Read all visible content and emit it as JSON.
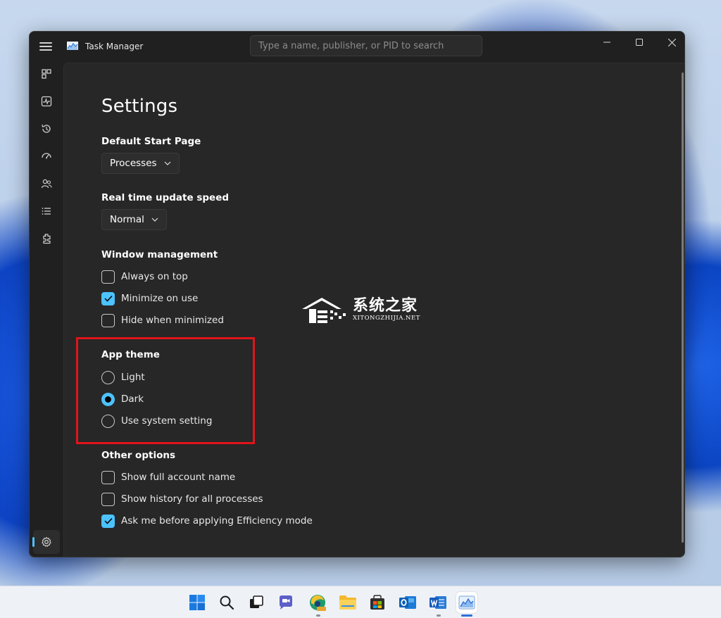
{
  "window": {
    "title": "Task Manager",
    "search_placeholder": "Type a name, publisher, or PID to search"
  },
  "nav": {
    "items": [
      "processes-icon",
      "performance-icon",
      "app-history-icon",
      "startup-apps-icon",
      "users-icon",
      "details-icon",
      "services-icon"
    ],
    "footer": "settings-icon"
  },
  "settings": {
    "title": "Settings",
    "default_start_page": {
      "label": "Default Start Page",
      "value": "Processes"
    },
    "update_speed": {
      "label": "Real time update speed",
      "value": "Normal"
    },
    "window_management": {
      "label": "Window management",
      "options": [
        {
          "label": "Always on top",
          "checked": false
        },
        {
          "label": "Minimize on use",
          "checked": true
        },
        {
          "label": "Hide when minimized",
          "checked": false
        }
      ]
    },
    "app_theme": {
      "label": "App theme",
      "options": [
        {
          "label": "Light",
          "selected": false
        },
        {
          "label": "Dark",
          "selected": true
        },
        {
          "label": "Use system setting",
          "selected": false
        }
      ]
    },
    "other_options": {
      "label": "Other options",
      "options": [
        {
          "label": "Show full account name",
          "checked": false
        },
        {
          "label": "Show history for all processes",
          "checked": false
        },
        {
          "label": "Ask me before applying Efficiency mode",
          "checked": true
        }
      ]
    }
  },
  "watermark": {
    "cn": "系统之家",
    "en": "XITONGZHIJIA.NET"
  },
  "taskbar": {
    "icons": [
      "start-icon",
      "search-icon",
      "task-view-icon",
      "teams-chat-icon",
      "edge-canary-icon",
      "file-explorer-icon",
      "microsoft-store-icon",
      "outlook-icon",
      "word-icon",
      "task-manager-icon"
    ]
  },
  "colors": {
    "accent": "#4cc2ff",
    "highlight_border": "#e0141b",
    "window_bg": "#202020",
    "content_bg": "#272727"
  }
}
